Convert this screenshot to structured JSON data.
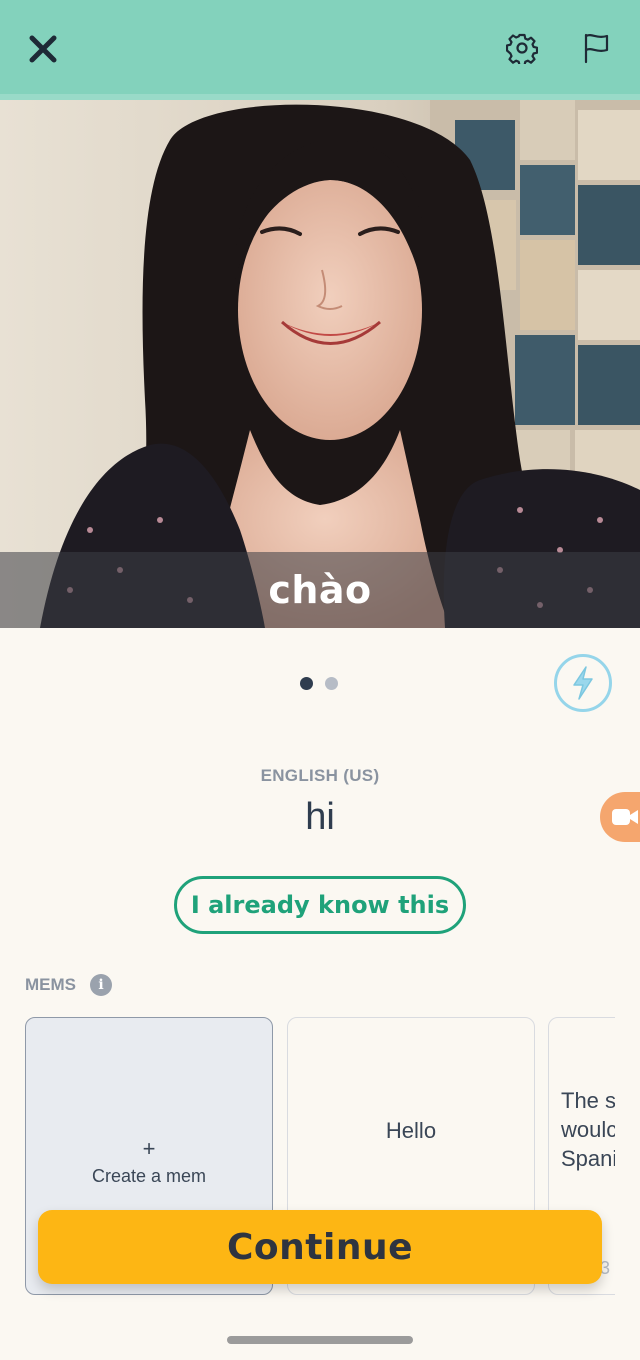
{
  "header": {
    "close_icon": "close-x-icon",
    "settings_icon": "gear-icon",
    "report_icon": "flag-icon",
    "background_color": "#83d2bc"
  },
  "media": {
    "caption": "chào"
  },
  "pager": {
    "current_page": 1,
    "total_pages": 2
  },
  "difficulty_icon": "bolt-icon",
  "prompt": {
    "language_label": "ENGLISH (US)",
    "translation": "hi"
  },
  "actions": {
    "know_this_label": "I already know this",
    "continue_label": "Continue"
  },
  "video_fab_icon": "video-camera-icon",
  "mems": {
    "label": "MEMS",
    "info_icon": "i",
    "create": {
      "plus": "+",
      "label": "Create a mem"
    },
    "cards": [
      {
        "text": "Hello"
      },
      {
        "text": "The s\nwoulc\nSpani",
        "count": "3"
      }
    ]
  },
  "colors": {
    "accent_green": "#1fa27a",
    "continue_yellow": "#fdb614",
    "bolt_blue": "#95d5ea",
    "fab_orange": "#f5a66e"
  }
}
